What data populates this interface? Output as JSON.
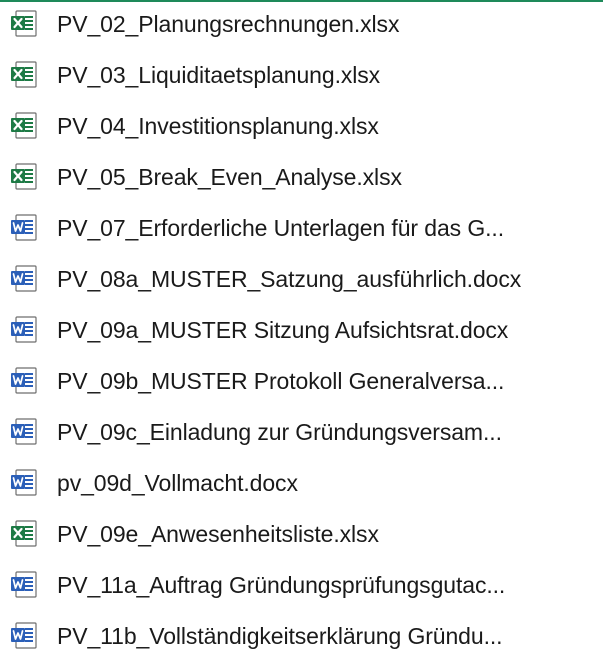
{
  "files": [
    {
      "name": "PV_02_Planungsrechnungen.xlsx",
      "type": "xlsx",
      "icon": "excel-file-icon"
    },
    {
      "name": "PV_03_Liquiditaetsplanung.xlsx",
      "type": "xlsx",
      "icon": "excel-file-icon"
    },
    {
      "name": "PV_04_Investitionsplanung.xlsx",
      "type": "xlsx",
      "icon": "excel-file-icon"
    },
    {
      "name": "PV_05_Break_Even_Analyse.xlsx",
      "type": "xlsx",
      "icon": "excel-file-icon"
    },
    {
      "name": "PV_07_Erforderliche Unterlagen für das G...",
      "type": "docx",
      "icon": "word-file-icon"
    },
    {
      "name": "PV_08a_MUSTER_Satzung_ausführlich.docx",
      "type": "docx",
      "icon": "word-file-icon"
    },
    {
      "name": "PV_09a_MUSTER Sitzung Aufsichtsrat.docx",
      "type": "docx",
      "icon": "word-file-icon"
    },
    {
      "name": "PV_09b_MUSTER Protokoll Generalversa...",
      "type": "docx",
      "icon": "word-file-icon"
    },
    {
      "name": "PV_09c_Einladung zur Gründungsversam...",
      "type": "docx",
      "icon": "word-file-icon"
    },
    {
      "name": "pv_09d_Vollmacht.docx",
      "type": "docx",
      "icon": "word-file-icon"
    },
    {
      "name": "PV_09e_Anwesenheitsliste.xlsx",
      "type": "xlsx",
      "icon": "excel-file-icon"
    },
    {
      "name": "PV_11a_Auftrag Gründungsprüfungsgutac...",
      "type": "docx",
      "icon": "word-file-icon"
    },
    {
      "name": "PV_11b_Vollständigkeitserklärung Gründu...",
      "type": "docx",
      "icon": "word-file-icon"
    }
  ],
  "colors": {
    "excel": "#1d7a45",
    "word": "#2b5fb8",
    "accent_line": "#1e8a5a"
  }
}
